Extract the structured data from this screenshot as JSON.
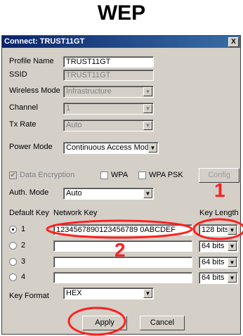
{
  "heading": "WEP",
  "dialog": {
    "title": "Connect: TRUST11GT",
    "close_label": "X",
    "profile_name": {
      "label": "Profile Name",
      "value": "TRUST11GT"
    },
    "ssid": {
      "label": "SSID",
      "value": "TRUST11GT"
    },
    "wireless_mode": {
      "label": "Wireless Mode",
      "value": "Infrastructure"
    },
    "channel": {
      "label": "Channel",
      "value": "1"
    },
    "tx_rate": {
      "label": "Tx Rate",
      "value": "Auto"
    },
    "power_mode": {
      "label": "Power Mode",
      "value": "Continuous Access Mode"
    },
    "data_encryption": {
      "label": "Data Encryption",
      "checked": true
    },
    "wpa": {
      "label": "WPA",
      "checked": false
    },
    "wpa_psk": {
      "label": "WPA PSK",
      "checked": false
    },
    "config_label": "Config",
    "auth_mode": {
      "label": "Auth. Mode",
      "value": "Auto"
    },
    "headers": {
      "default_key": "Default Key",
      "network_key": "Network Key",
      "key_length": "Key Length"
    },
    "keys": [
      {
        "num": "1",
        "value": "1234567890123456789 0ABCDEF",
        "length": "128 bits",
        "selected": true
      },
      {
        "num": "2",
        "value": "",
        "length": "64 bits",
        "selected": false
      },
      {
        "num": "3",
        "value": "",
        "length": "64 bits",
        "selected": false
      },
      {
        "num": "4",
        "value": "",
        "length": "64 bits",
        "selected": false
      }
    ],
    "key_format": {
      "label": "Key Format",
      "value": "HEX"
    },
    "apply_label": "Apply",
    "cancel_label": "Cancel"
  },
  "annotations": {
    "mark1": "1",
    "mark2": "2",
    "color": "#ff2020"
  }
}
